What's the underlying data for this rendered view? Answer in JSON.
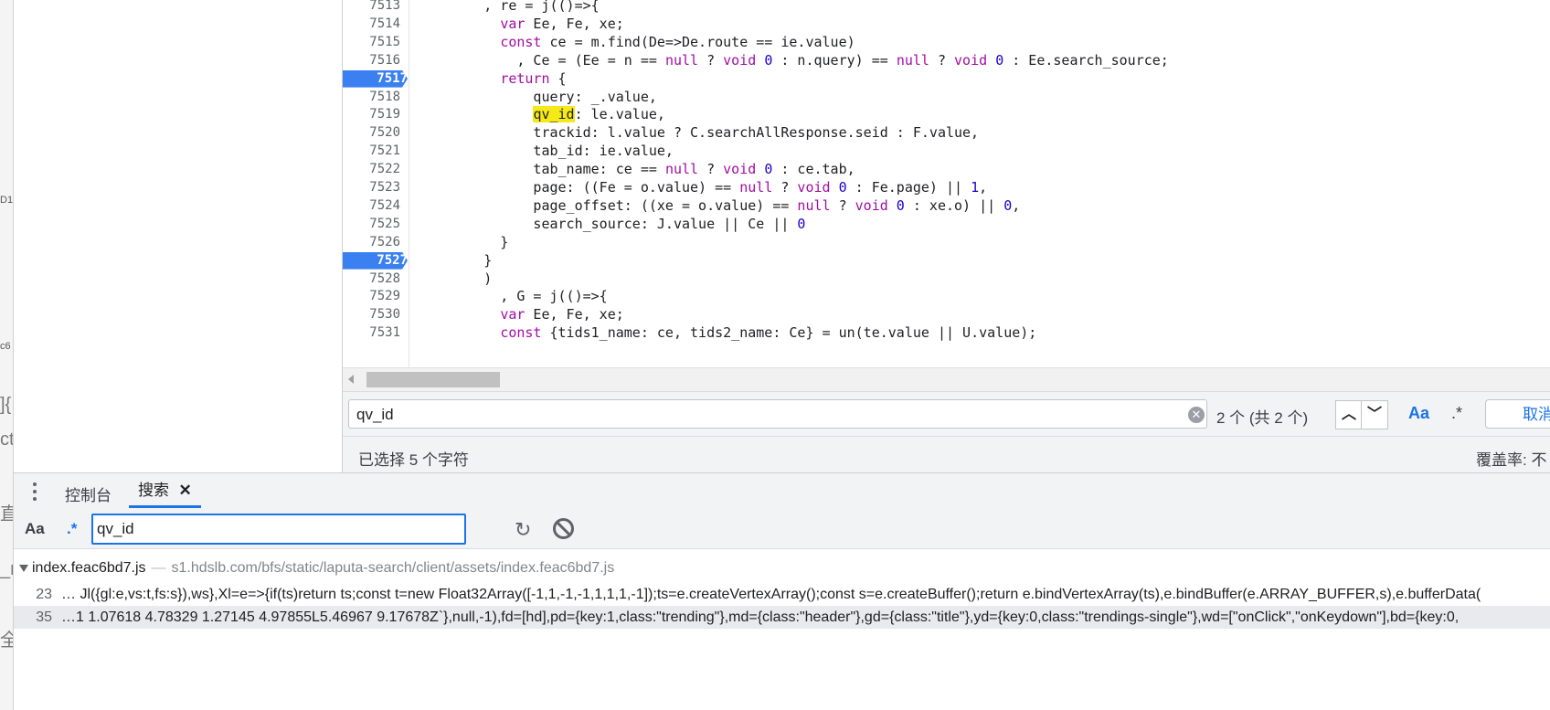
{
  "left_strip": {
    "frag1": "D1",
    "frag2": "c6",
    "frag3": "]{",
    "frag4": "ct",
    "frag5": "直",
    "frag6": "_r",
    "frag7": "全"
  },
  "editor": {
    "lines": [
      {
        "n": "7513",
        "bp": false,
        "tokens": [
          {
            "t": "        , re = j(()=>{"
          }
        ]
      },
      {
        "n": "7514",
        "bp": false,
        "tokens": [
          {
            "t": "          "
          },
          {
            "t": "var",
            "c": "kw"
          },
          {
            "t": " Ee, Fe, xe;"
          }
        ]
      },
      {
        "n": "7515",
        "bp": false,
        "tokens": [
          {
            "t": "          "
          },
          {
            "t": "const",
            "c": "kw"
          },
          {
            "t": " ce = m.find(De=>De.route == ie.value)"
          }
        ]
      },
      {
        "n": "7516",
        "bp": false,
        "tokens": [
          {
            "t": "            , Ce = (Ee = n == "
          },
          {
            "t": "null",
            "c": "kw"
          },
          {
            "t": " ? "
          },
          {
            "t": "void",
            "c": "kw"
          },
          {
            "t": " "
          },
          {
            "t": "0",
            "c": "num"
          },
          {
            "t": " : n.query) == "
          },
          {
            "t": "null",
            "c": "kw"
          },
          {
            "t": " ? "
          },
          {
            "t": "void",
            "c": "kw"
          },
          {
            "t": " "
          },
          {
            "t": "0",
            "c": "num"
          },
          {
            "t": " : Ee.search_source;"
          }
        ]
      },
      {
        "n": "7517",
        "bp": true,
        "tokens": [
          {
            "t": "          "
          },
          {
            "t": "return",
            "c": "kw"
          },
          {
            "t": " {"
          }
        ]
      },
      {
        "n": "7518",
        "bp": false,
        "tokens": [
          {
            "t": "              query: _.value,"
          }
        ]
      },
      {
        "n": "7519",
        "bp": false,
        "tokens": [
          {
            "t": "              "
          },
          {
            "t": "qv_id",
            "c": "hl"
          },
          {
            "t": ": le.value,"
          }
        ]
      },
      {
        "n": "7520",
        "bp": false,
        "tokens": [
          {
            "t": "              trackid: l.value ? C.searchAllResponse.seid : F.value,"
          }
        ]
      },
      {
        "n": "7521",
        "bp": false,
        "tokens": [
          {
            "t": "              tab_id: ie.value,"
          }
        ]
      },
      {
        "n": "7522",
        "bp": false,
        "tokens": [
          {
            "t": "              tab_name: ce == "
          },
          {
            "t": "null",
            "c": "kw"
          },
          {
            "t": " ? "
          },
          {
            "t": "void",
            "c": "kw"
          },
          {
            "t": " "
          },
          {
            "t": "0",
            "c": "num"
          },
          {
            "t": " : ce.tab,"
          }
        ]
      },
      {
        "n": "7523",
        "bp": false,
        "tokens": [
          {
            "t": "              page: ((Fe = o.value) == "
          },
          {
            "t": "null",
            "c": "kw"
          },
          {
            "t": " ? "
          },
          {
            "t": "void",
            "c": "kw"
          },
          {
            "t": " "
          },
          {
            "t": "0",
            "c": "num"
          },
          {
            "t": " : Fe.page) || "
          },
          {
            "t": "1",
            "c": "num"
          },
          {
            "t": ","
          }
        ]
      },
      {
        "n": "7524",
        "bp": false,
        "tokens": [
          {
            "t": "              page_offset: ((xe = o.value) == "
          },
          {
            "t": "null",
            "c": "kw"
          },
          {
            "t": " ? "
          },
          {
            "t": "void",
            "c": "kw"
          },
          {
            "t": " "
          },
          {
            "t": "0",
            "c": "num"
          },
          {
            "t": " : xe.o) || "
          },
          {
            "t": "0",
            "c": "num"
          },
          {
            "t": ","
          }
        ]
      },
      {
        "n": "7525",
        "bp": false,
        "tokens": [
          {
            "t": "              search_source: J.value || Ce || "
          },
          {
            "t": "0",
            "c": "num"
          }
        ]
      },
      {
        "n": "7526",
        "bp": false,
        "tokens": [
          {
            "t": "          }"
          }
        ]
      },
      {
        "n": "7527",
        "bp": true,
        "tokens": [
          {
            "t": "        }"
          }
        ]
      },
      {
        "n": "7528",
        "bp": false,
        "tokens": [
          {
            "t": "        )"
          }
        ]
      },
      {
        "n": "7529",
        "bp": false,
        "tokens": [
          {
            "t": "          , G = j(()=>{"
          }
        ]
      },
      {
        "n": "7530",
        "bp": false,
        "tokens": [
          {
            "t": "          "
          },
          {
            "t": "var",
            "c": "kw"
          },
          {
            "t": " Ee, Fe, xe;"
          }
        ]
      },
      {
        "n": "7531",
        "bp": false,
        "tokens": [
          {
            "t": "          "
          },
          {
            "t": "const",
            "c": "kw"
          },
          {
            "t": " {tids1_name: ce, tids2_name: Ce} = un(te.value || U.value);"
          }
        ]
      }
    ]
  },
  "findbar": {
    "query": "qv_id",
    "count": "2 个 (共 2 个)",
    "case_label": "Aa",
    "regex_label": ".*",
    "cancel_label": "取消",
    "prev_icon": "chevron-up-icon",
    "next_icon": "chevron-down-icon"
  },
  "status": {
    "selection": "已选择 5 个字符",
    "coverage": "覆盖率: 不"
  },
  "drawer": {
    "tab_console": "控制台",
    "tab_search": "搜索",
    "close_glyph": "✕"
  },
  "search": {
    "case_label": "Aa",
    "regex_label": ".*",
    "query": "qv_id"
  },
  "results": {
    "file_name": "index.feac6bd7.js",
    "file_sep": "—",
    "file_path": "s1.hdslb.com/bfs/static/laputa-search/client/assets/index.feac6bd7.js",
    "rows": [
      {
        "line": "23",
        "text": "… Jl({gl:e,vs:t,fs:s}),ws},Xl=e=>{if(ts)return ts;const t=new Float32Array([-1,1,-1,-1,1,1,1,-1]);ts=e.createVertexArray();const s=e.createBuffer();return e.bindVertexArray(ts),e.bindBuffer(e.ARRAY_BUFFER,s),e.bufferData(",
        "selected": false
      },
      {
        "line": "35",
        "text": "…1 1.07618 4.78329 1.27145 4.97855L5.46967 9.17678Z`},null,-1),fd=[hd],pd={key:1,class:\"trending\"},md={class:\"header\"},gd={class:\"title\"},yd={key:0,class:\"trendings-single\"},wd=[\"onClick\",\"onKeydown\"],bd={key:0,",
        "selected": true
      }
    ]
  }
}
